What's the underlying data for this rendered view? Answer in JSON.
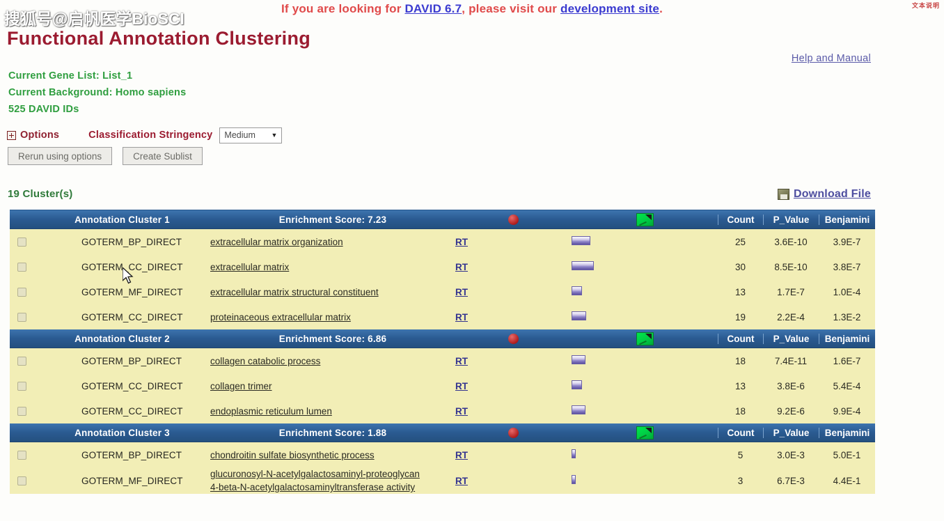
{
  "banner": {
    "prefix": "If you are looking for ",
    "link1": "DAVID 6.7",
    "middle": ", please visit our ",
    "link2": "development site",
    "suffix": ".",
    "cjk_note": "文本说明"
  },
  "watermark": "搜狐号@启帆医学BioSCI",
  "page_title": "Functional Annotation Clustering",
  "help_link": "Help and Manual",
  "info": {
    "gene_list": "Current Gene List: List_1",
    "background": "Current Background: Homo sapiens",
    "ids": "525 DAVID IDs"
  },
  "options": {
    "label": "Options",
    "stringency_label": "Classification Stringency",
    "stringency_value": "Medium",
    "caret": "▼",
    "rerun_button": "Rerun using options",
    "sublist_button": "Create Sublist"
  },
  "cluster_count": "19 Cluster(s)",
  "download": {
    "label": "Download File",
    "icon": "download-disk-icon"
  },
  "columns": {
    "count": "Count",
    "pvalue": "P_Value",
    "benjamini": "Benjamini"
  },
  "icons": {
    "red": "red-circle-icon",
    "green": "green-chart-icon",
    "rt": "RT"
  },
  "clusters": [
    {
      "title": "Annotation Cluster 1",
      "score": "Enrichment Score: 7.23",
      "rows": [
        {
          "category": "GOTERM_BP_DIRECT",
          "term": "extracellular matrix organization",
          "rt": "RT",
          "bar": 26,
          "count": "25",
          "pvalue": "3.6E-10",
          "benjamini": "3.9E-7"
        },
        {
          "category": "GOTERM_CC_DIRECT",
          "term": "extracellular matrix",
          "rt": "RT",
          "bar": 30,
          "count": "30",
          "pvalue": "8.5E-10",
          "benjamini": "3.8E-7"
        },
        {
          "category": "GOTERM_MF_DIRECT",
          "term": "extracellular matrix structural constituent",
          "rt": "RT",
          "bar": 14,
          "count": "13",
          "pvalue": "1.7E-7",
          "benjamini": "1.0E-4"
        },
        {
          "category": "GOTERM_CC_DIRECT",
          "term": "proteinaceous extracellular matrix",
          "rt": "RT",
          "bar": 20,
          "count": "19",
          "pvalue": "2.2E-4",
          "benjamini": "1.3E-2"
        }
      ]
    },
    {
      "title": "Annotation Cluster 2",
      "score": "Enrichment Score: 6.86",
      "rows": [
        {
          "category": "GOTERM_BP_DIRECT",
          "term": "collagen catabolic process",
          "rt": "RT",
          "bar": 19,
          "count": "18",
          "pvalue": "7.4E-11",
          "benjamini": "1.6E-7"
        },
        {
          "category": "GOTERM_CC_DIRECT",
          "term": "collagen trimer",
          "rt": "RT",
          "bar": 14,
          "count": "13",
          "pvalue": "3.8E-6",
          "benjamini": "5.4E-4"
        },
        {
          "category": "GOTERM_CC_DIRECT",
          "term": "endoplasmic reticulum lumen",
          "rt": "RT",
          "bar": 19,
          "count": "18",
          "pvalue": "9.2E-6",
          "benjamini": "9.9E-4"
        }
      ]
    },
    {
      "title": "Annotation Cluster 3",
      "score": "Enrichment Score: 1.88",
      "rows": [
        {
          "category": "GOTERM_BP_DIRECT",
          "term": "chondroitin sulfate biosynthetic process",
          "rt": "RT",
          "bar": 6,
          "count": "5",
          "pvalue": "3.0E-3",
          "benjamini": "5.0E-1"
        },
        {
          "category": "GOTERM_MF_DIRECT",
          "term": "glucuronosyl-N-acetylgalactosaminyl-proteoglycan 4-beta-N-acetylgalactosaminyltransferase activity",
          "rt": "RT",
          "bar": 4,
          "count": "3",
          "pvalue": "6.7E-3",
          "benjamini": "4.4E-1"
        }
      ]
    }
  ]
}
